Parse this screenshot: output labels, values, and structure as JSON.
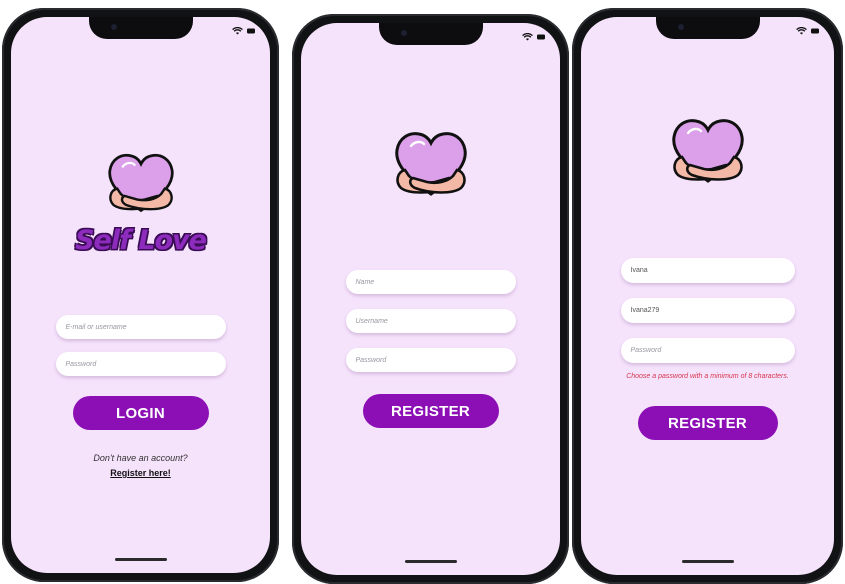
{
  "status_icons": [
    "wifi-icon",
    "battery-icon"
  ],
  "colors": {
    "screen_bg": "#f5e2fb",
    "button_bg": "#8b0fb5",
    "error_text": "#d8364d",
    "brand_text": "#8d2bbd"
  },
  "login_screen": {
    "logo_icon": "heart-hug-icon",
    "brand_title": "Self Love",
    "email_placeholder": "E-mail or username",
    "password_placeholder": "Password",
    "login_button": "LOGIN",
    "signup_prompt": "Don't have an account?",
    "register_link": "Register here!"
  },
  "register_screen": {
    "logo_icon": "heart-hug-icon",
    "name_placeholder": "Name",
    "username_placeholder": "Username",
    "password_placeholder": "Password",
    "register_button": "REGISTER"
  },
  "register_error_screen": {
    "logo_icon": "heart-hug-icon",
    "name_value": "Ivana",
    "username_value": "Ivana279",
    "password_placeholder": "Password",
    "error_message": "Choose a password with a minimum of 8 characters.",
    "register_button": "REGISTER"
  }
}
